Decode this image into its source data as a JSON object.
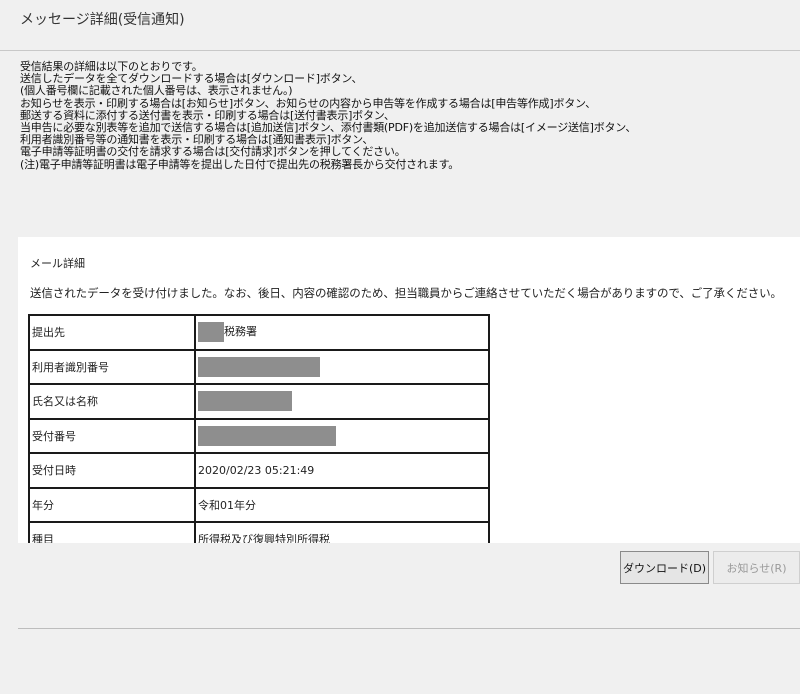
{
  "window": {
    "title": "メッセージ詳細(受信通知)"
  },
  "instructions": [
    "受信結果の詳細は以下のとおりです。",
    "送信したデータを全てダウンロードする場合は[ダウンロード]ボタン、",
    "(個人番号欄に記載された個人番号は、表示されません。)",
    "お知らせを表示・印刷する場合は[お知らせ]ボタン、お知らせの内容から申告等を作成する場合は[申告等作成]ボタン、",
    "郵送する資料に添付する送付書を表示・印刷する場合は[送付書表示]ボタン、",
    "当申告に必要な別表等を追加で送信する場合は[追加送信]ボタン、添付書類(PDF)を追加送信する場合は[イメージ送信]ボタン、",
    "利用者識別番号等の通知書を表示・印刷する場合は[通知書表示]ボタン、",
    "電子申請等証明書の交付を請求する場合は[交付請求]ボタンを押してください。",
    "(注)電子申請等証明書は電子申請等を提出した日付で提出先の税務署長から交付されます。"
  ],
  "mail": {
    "heading": "メール詳細",
    "message": "送信されたデータを受け付けました。なお、後日、内容の確認のため、担当職員からご連絡させていただく場合がありますので、ご了承ください。",
    "rows": [
      {
        "label": "提出先",
        "value": "税務署",
        "redacted": true
      },
      {
        "label": "利用者識別番号",
        "value": "",
        "redacted": true
      },
      {
        "label": "氏名又は名称",
        "value": "",
        "redacted": true
      },
      {
        "label": "受付番号",
        "value": "",
        "redacted": true
      },
      {
        "label": "受付日時",
        "value": "2020/02/23 05:21:49",
        "redacted": false
      },
      {
        "label": "年分",
        "value": "令和01年分",
        "redacted": false
      },
      {
        "label": "種目",
        "value": "所得税及び復興特別所得税",
        "redacted": false
      }
    ]
  },
  "buttons": {
    "download": "ダウンロード(D)",
    "notice": "お知らせ(R)"
  },
  "colors": {
    "background": "#f0f0f0",
    "panel": "#ffffff",
    "redaction": "#8e8e8e"
  }
}
